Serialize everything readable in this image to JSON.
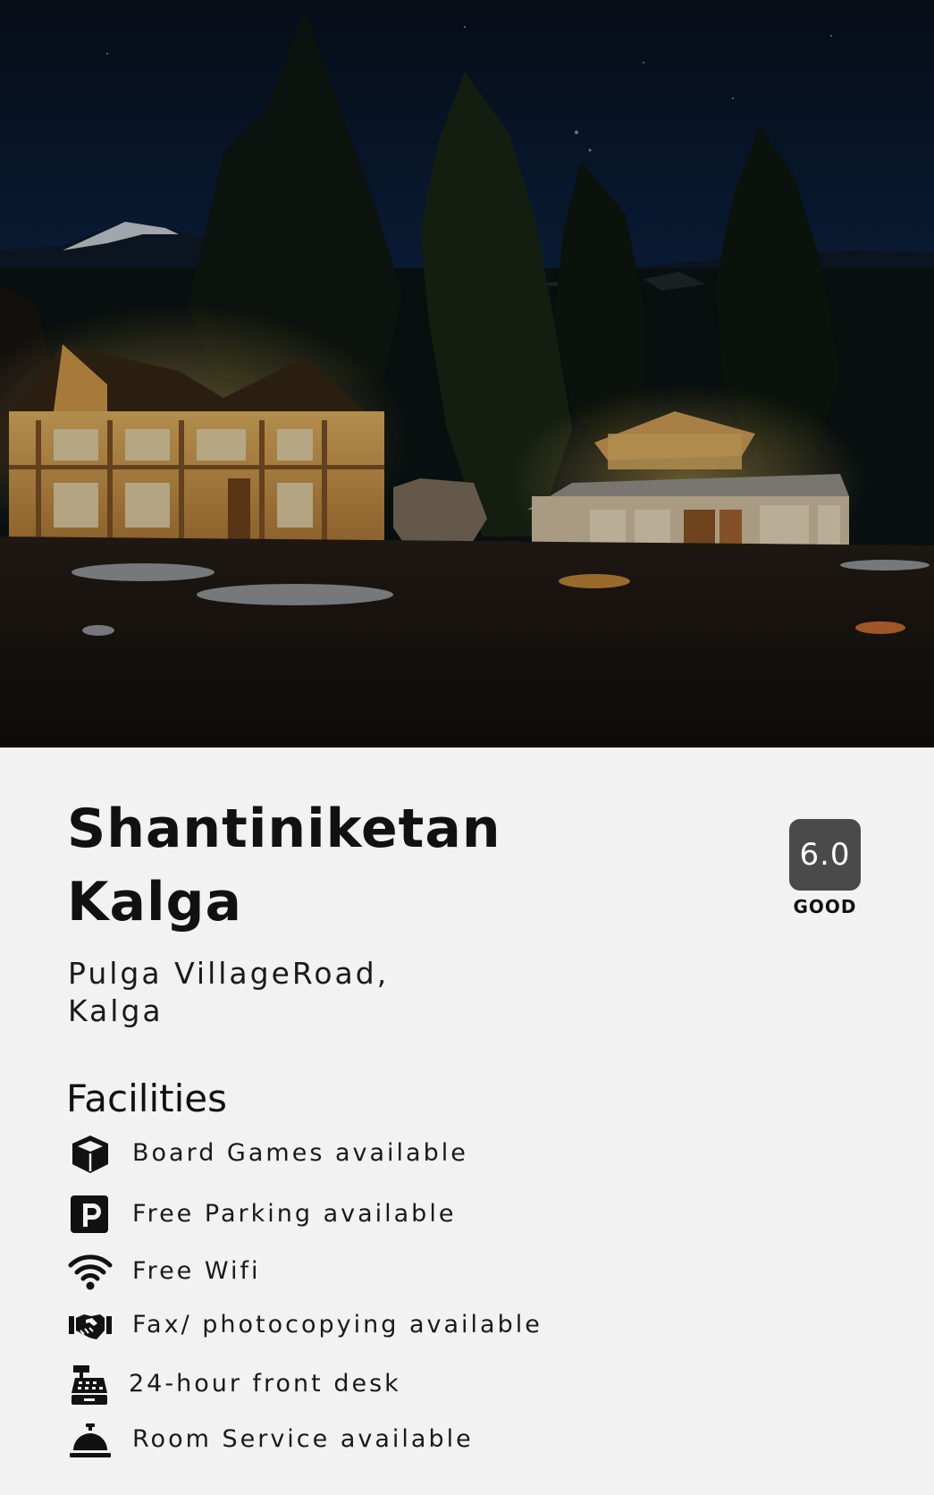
{
  "hotel": {
    "name": "Shantiniketan Kalga",
    "address": "Pulga VillageRoad, Kalga",
    "image_alt": "Night view of illuminated wooden cottages beneath pine trees and snow-capped mountains"
  },
  "rating": {
    "score": "6.0",
    "label": "GOOD",
    "badge_color": "#4a4a4a"
  },
  "facilities": {
    "heading": "Facilities",
    "items": [
      {
        "icon": "cube-icon",
        "label": "Board Games available"
      },
      {
        "icon": "parking-icon",
        "label": "Free Parking available"
      },
      {
        "icon": "wifi-icon",
        "label": "Free Wifi"
      },
      {
        "icon": "handshake-icon",
        "label": "Fax/ photocopying available"
      },
      {
        "icon": "cash-register-icon",
        "label": "24-hour front desk"
      },
      {
        "icon": "concierge-bell-icon",
        "label": "Room Service available"
      }
    ]
  }
}
